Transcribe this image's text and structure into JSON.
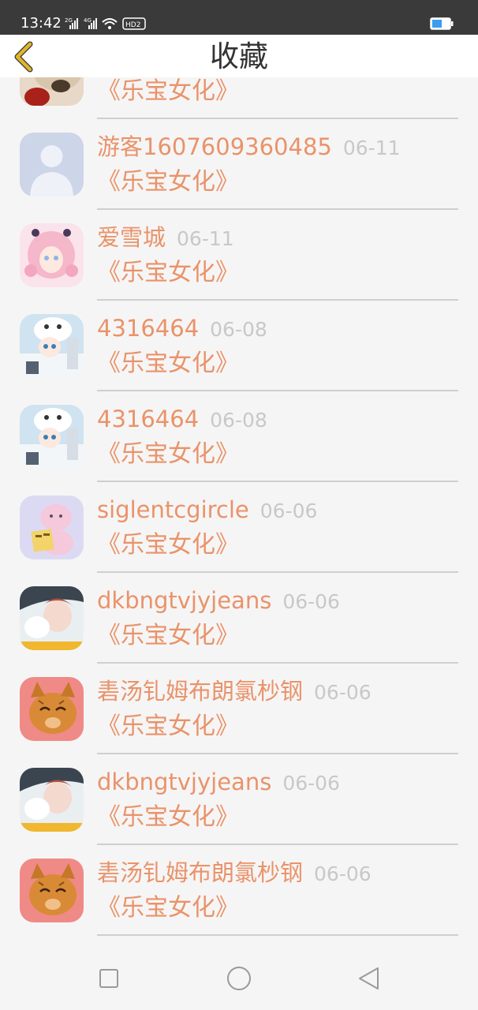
{
  "status_bar": {
    "time": "13:42",
    "signal_labels": [
      "2G",
      "4G",
      "HD2"
    ],
    "battery_color": "#3b9cf0"
  },
  "header": {
    "title": "收藏",
    "back_icon": "chevron-left-icon",
    "back_color": "#e0b52b"
  },
  "list": {
    "partial_item": {
      "work": "《乐宝女化》"
    },
    "items": [
      {
        "name": "游客1607609360485",
        "date": "06-11",
        "work": "《乐宝女化》",
        "avatar": "default-user-icon"
      },
      {
        "name": "爱雪城",
        "date": "06-11",
        "work": "《乐宝女化》",
        "avatar": "pink-anime-girl-avatar"
      },
      {
        "name": "4316464",
        "date": "06-08",
        "work": "《乐宝女化》",
        "avatar": "anime-cat-hat-avatar"
      },
      {
        "name": "4316464",
        "date": "06-08",
        "work": "《乐宝女化》",
        "avatar": "anime-cat-hat-avatar"
      },
      {
        "name": "siglentcgircle",
        "date": "06-06",
        "work": "《乐宝女化》",
        "avatar": "pink-cat-book-avatar"
      },
      {
        "name": "dkbngtvjyjeans",
        "date": "06-06",
        "work": "《乐宝女化》",
        "avatar": "portrait-photo-avatar"
      },
      {
        "name": "砉汤钆姆布朗氯杪钢",
        "date": "06-06",
        "work": "《乐宝女化》",
        "avatar": "orange-cat-avatar"
      },
      {
        "name": "dkbngtvjyjeans",
        "date": "06-06",
        "work": "《乐宝女化》",
        "avatar": "portrait-photo-avatar"
      },
      {
        "name": "砉汤钆姆布朗氯杪钢",
        "date": "06-06",
        "work": "《乐宝女化》",
        "avatar": "orange-cat-avatar"
      }
    ]
  },
  "nav_bar": {
    "buttons": [
      "square-recents-icon",
      "circle-home-icon",
      "triangle-back-icon"
    ]
  },
  "colors": {
    "accent_text": "#e9936a",
    "date_text": "#c8c8c8",
    "divider": "#cfcfcf",
    "background": "#f6f5f5"
  }
}
